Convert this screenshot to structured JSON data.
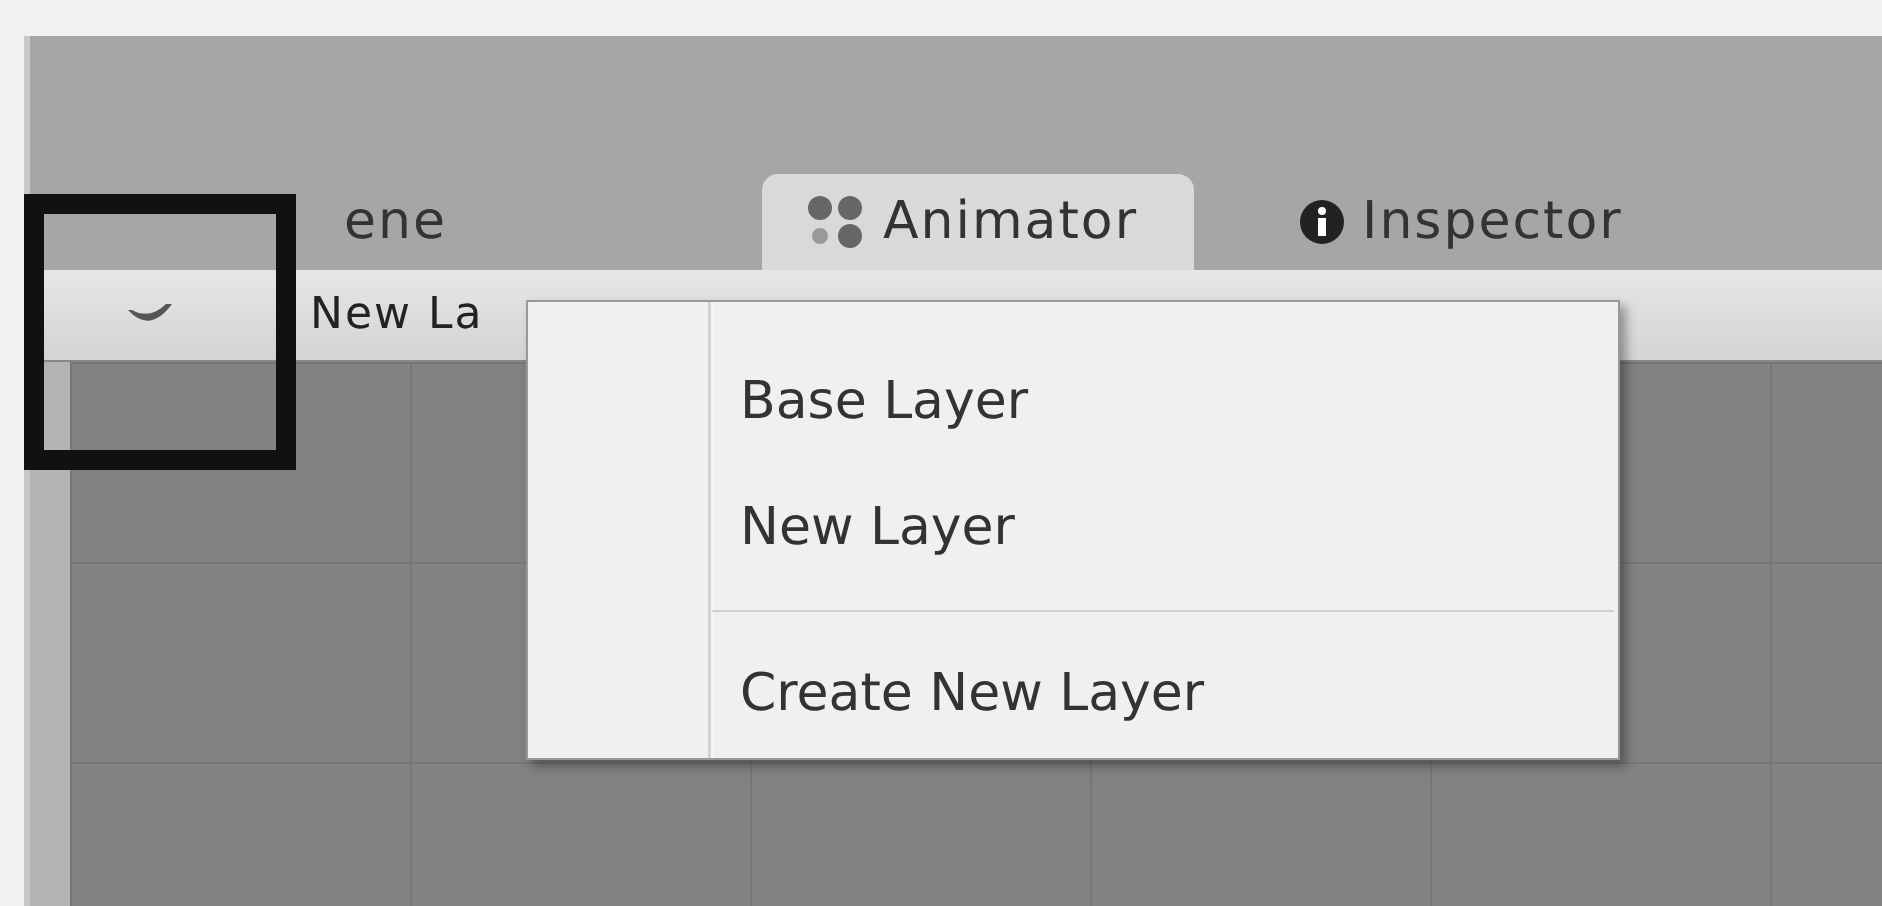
{
  "tabs": [
    {
      "kind": "scene",
      "label": "ene",
      "selected": false
    },
    {
      "kind": "animator",
      "label": "Animator",
      "selected": true
    },
    {
      "kind": "inspector",
      "label": "Inspector",
      "selected": false
    }
  ],
  "toolbar": {
    "layer_label": "New La"
  },
  "menu": {
    "items": [
      {
        "kind": "item",
        "label": "Base Layer"
      },
      {
        "kind": "item",
        "label": "New Layer"
      },
      {
        "kind": "separator"
      },
      {
        "kind": "item",
        "label": "Create New Layer"
      }
    ]
  },
  "highlight": {
    "shown": true
  }
}
